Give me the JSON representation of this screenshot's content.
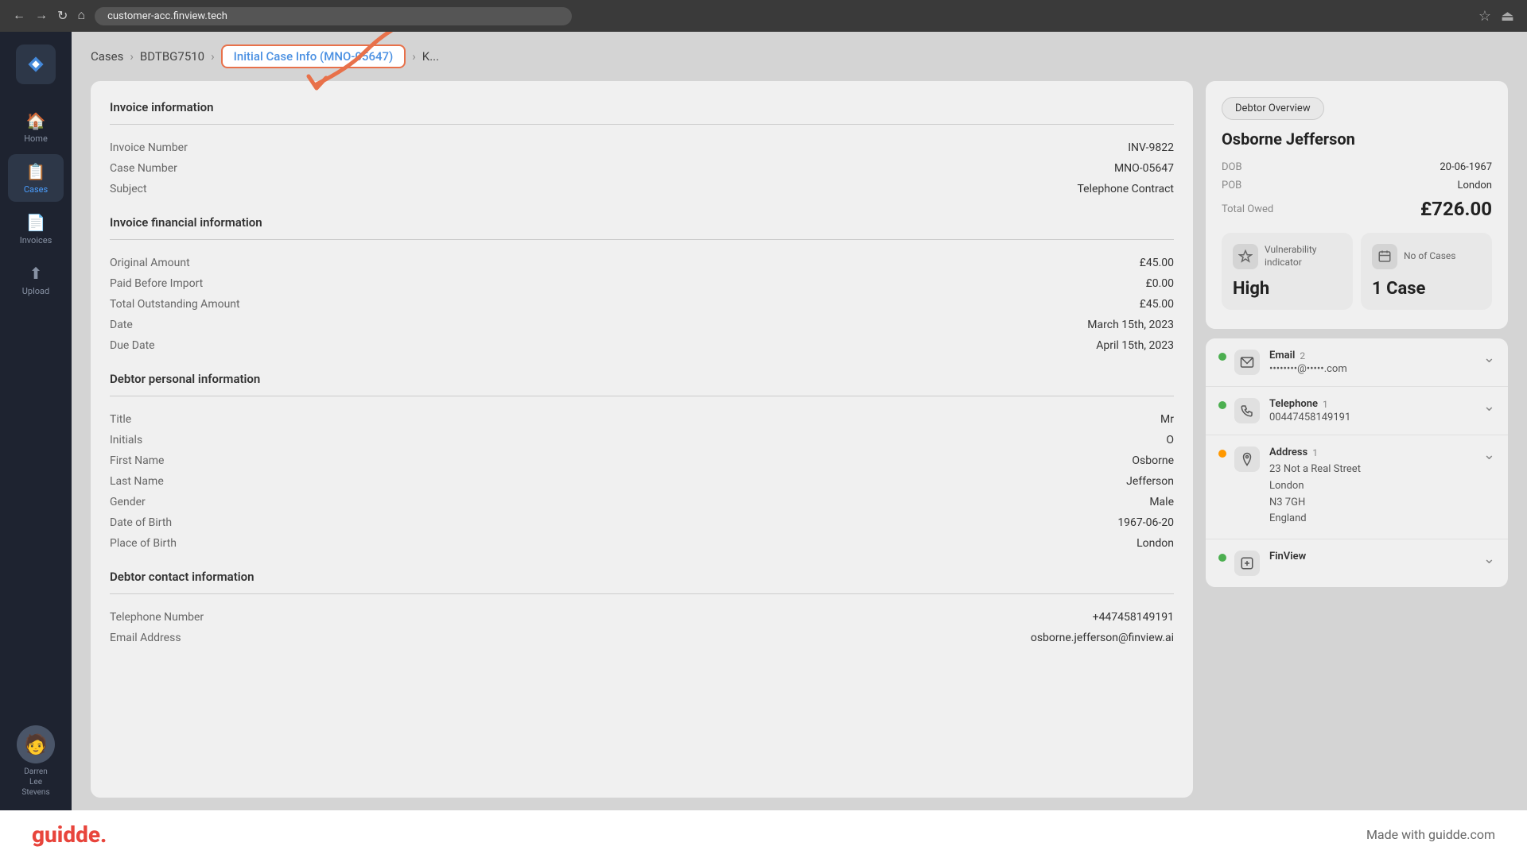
{
  "browser": {
    "url": "customer-acc.finview.tech"
  },
  "breadcrumb": {
    "items": [
      "Cases",
      "BDTBG7510",
      "Initial Case Info (MNO-05647)",
      "K..."
    ]
  },
  "invoice_info": {
    "section_title": "Invoice information",
    "fields": [
      {
        "label": "Invoice Number",
        "value": "INV-9822"
      },
      {
        "label": "Case Number",
        "value": "MNO-05647"
      },
      {
        "label": "Subject",
        "value": "Telephone Contract"
      }
    ]
  },
  "invoice_financial": {
    "section_title": "Invoice financial information",
    "fields": [
      {
        "label": "Original Amount",
        "value": "£45.00"
      },
      {
        "label": "Paid Before Import",
        "value": "£0.00"
      },
      {
        "label": "Total Outstanding Amount",
        "value": "£45.00"
      },
      {
        "label": "Date",
        "value": "March 15th, 2023"
      },
      {
        "label": "Due Date",
        "value": "April 15th, 2023"
      }
    ]
  },
  "debtor_personal": {
    "section_title": "Debtor personal information",
    "fields": [
      {
        "label": "Title",
        "value": "Mr"
      },
      {
        "label": "Initials",
        "value": "O"
      },
      {
        "label": "First Name",
        "value": "Osborne"
      },
      {
        "label": "Last Name",
        "value": "Jefferson"
      },
      {
        "label": "Gender",
        "value": "Male"
      },
      {
        "label": "Date of Birth",
        "value": "1967-06-20"
      },
      {
        "label": "Place of Birth",
        "value": "London"
      }
    ]
  },
  "debtor_contact": {
    "section_title": "Debtor contact information",
    "fields": [
      {
        "label": "Telephone Number",
        "value": "+447458149191"
      },
      {
        "label": "Email Address",
        "value": "osborne.jefferson@finview.ai"
      }
    ]
  },
  "sidebar": {
    "items": [
      {
        "label": "Home",
        "icon": "🏠",
        "active": false
      },
      {
        "label": "Cases",
        "icon": "📋",
        "active": true
      },
      {
        "label": "Invoices",
        "icon": "📄",
        "active": false
      },
      {
        "label": "Upload",
        "icon": "⬆",
        "active": false
      }
    ],
    "user": {
      "name": "Darren\nLee\nStevens",
      "avatar": "🧑"
    }
  },
  "right_panel": {
    "debtor_overview_btn": "Debtor Overview",
    "debtor_name": "Osborne Jefferson",
    "dob_label": "DOB",
    "dob_value": "20-06-1967",
    "pob_label": "POB",
    "pob_value": "London",
    "total_owed_label": "Total Owed",
    "total_owed_value": "£726.00",
    "vulnerability": {
      "label": "Vulnerability\nindicator",
      "value": "High"
    },
    "no_of_cases": {
      "label": "No of Cases",
      "value": "1 Case"
    },
    "email": {
      "type": "Email",
      "count": "2",
      "value": "••••••••@•••••.com"
    },
    "telephone": {
      "type": "Telephone",
      "count": "1",
      "value": "00447458149191"
    },
    "address": {
      "type": "Address",
      "count": "1",
      "lines": [
        "23 Not a Real Street",
        "London",
        "N3 7GH",
        "England"
      ]
    },
    "finview_label": "FinView"
  },
  "footer": {
    "logo": "guidde.",
    "tagline": "Made with guidde.com"
  }
}
